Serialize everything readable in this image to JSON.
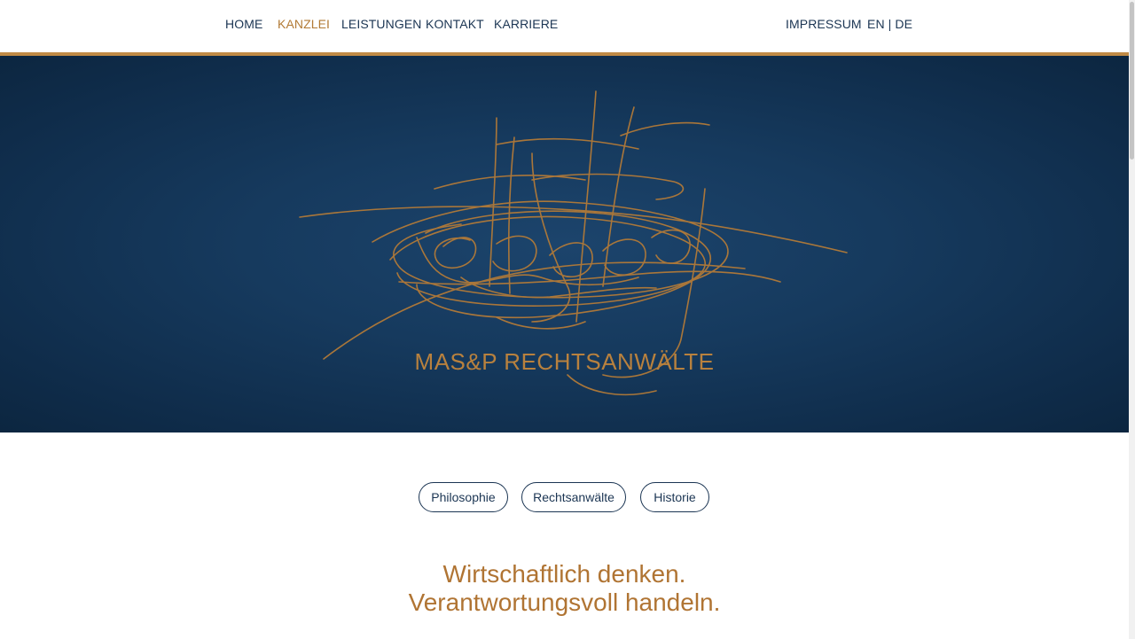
{
  "nav": {
    "items": [
      {
        "label": "HOME",
        "active": false
      },
      {
        "label": "KANZLEI",
        "active": true
      },
      {
        "label": "LEISTUNGEN",
        "active": false
      },
      {
        "label": "KONTAKT",
        "active": false
      },
      {
        "label": "KARRIERE",
        "active": false
      }
    ],
    "impressum": "IMPRESSUM",
    "language": "EN | DE"
  },
  "hero": {
    "logo_text": "MAS&P RECHTSANWÄLTE",
    "signature_icon": "signature-scribble-logo"
  },
  "tabs": [
    {
      "label": "Philosophie"
    },
    {
      "label": "Rechtsanwälte"
    },
    {
      "label": "Historie"
    }
  ],
  "tagline": {
    "line1": "Wirtschaftlich denken.",
    "line2": "Verantwortungsvoll handeln."
  },
  "colors": {
    "navy": "#1b3553",
    "gold": "#b8813e",
    "hero_bg": "#163a5e"
  }
}
